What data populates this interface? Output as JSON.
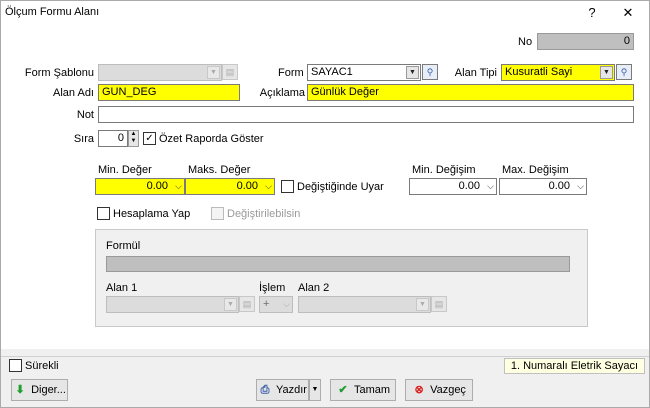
{
  "window": {
    "title": "Ölçum Formu Alanı",
    "help_label": "?",
    "close_label": "✕"
  },
  "no": {
    "label": "No",
    "value": "0"
  },
  "form_sablonu": {
    "label": "Form Şablonu",
    "value": ""
  },
  "form": {
    "label": "Form",
    "value": "SAYAC1"
  },
  "alan_tipi": {
    "label": "Alan Tipi",
    "value": "Kusuratli Sayi"
  },
  "alan_adi": {
    "label": "Alan Adı",
    "value": "GUN_DEG"
  },
  "aciklama": {
    "label": "Açıklama",
    "value": "Günlük Değer"
  },
  "not": {
    "label": "Not",
    "value": ""
  },
  "sira": {
    "label": "Sıra",
    "value": "0"
  },
  "ozet_raporda": {
    "label": "Özet Raporda Göster",
    "checked": true
  },
  "min_deger": {
    "label": "Min. Değer",
    "value": "0.00"
  },
  "maks_deger": {
    "label": "Maks. Değer",
    "value": "0.00"
  },
  "degistiginde_uyar": {
    "label": "Değiştiğinde Uyar",
    "checked": false
  },
  "min_degisim": {
    "label": "Min. Değişim",
    "value": "0.00"
  },
  "max_degisim": {
    "label": "Max. Değişim",
    "value": "0.00"
  },
  "hesaplama_yap": {
    "label": "Hesaplama Yap",
    "checked": false
  },
  "degistirilebilsin": {
    "label": "Değiştirilebilsin",
    "checked": false
  },
  "formul": {
    "label": "Formül",
    "value": ""
  },
  "alan1": {
    "label": "Alan 1",
    "value": ""
  },
  "islem": {
    "label": "İşlem",
    "value": "+"
  },
  "alan2": {
    "label": "Alan 2",
    "value": ""
  },
  "surekli": {
    "label": "Sürekli",
    "checked": false
  },
  "status_text": "1. Numaralı Eletrik Sayacı",
  "buttons": {
    "diger": "Diger...",
    "yazdir": "Yazdır",
    "tamam": "Tamam",
    "vazgec": "Vazgeç"
  },
  "colors": {
    "required_field": "#ffff00",
    "ok_icon": "#1e9e2e",
    "cancel_icon": "#d92020",
    "diger_icon": "#1e9e2e"
  },
  "icons": {
    "lookup": "lookup-icon",
    "dropdown": "chevron-down-icon",
    "checkmark": "checkmark-icon"
  }
}
